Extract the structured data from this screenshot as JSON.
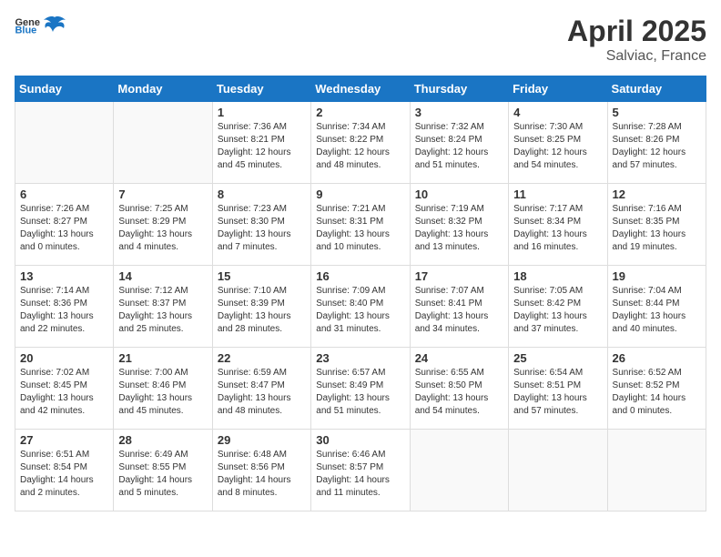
{
  "header": {
    "logo_general": "General",
    "logo_blue": "Blue",
    "title": "April 2025",
    "subtitle": "Salviac, France"
  },
  "days_of_week": [
    "Sunday",
    "Monday",
    "Tuesday",
    "Wednesday",
    "Thursday",
    "Friday",
    "Saturday"
  ],
  "weeks": [
    [
      {
        "day": "",
        "info": ""
      },
      {
        "day": "",
        "info": ""
      },
      {
        "day": "1",
        "info": "Sunrise: 7:36 AM\nSunset: 8:21 PM\nDaylight: 12 hours\nand 45 minutes."
      },
      {
        "day": "2",
        "info": "Sunrise: 7:34 AM\nSunset: 8:22 PM\nDaylight: 12 hours\nand 48 minutes."
      },
      {
        "day": "3",
        "info": "Sunrise: 7:32 AM\nSunset: 8:24 PM\nDaylight: 12 hours\nand 51 minutes."
      },
      {
        "day": "4",
        "info": "Sunrise: 7:30 AM\nSunset: 8:25 PM\nDaylight: 12 hours\nand 54 minutes."
      },
      {
        "day": "5",
        "info": "Sunrise: 7:28 AM\nSunset: 8:26 PM\nDaylight: 12 hours\nand 57 minutes."
      }
    ],
    [
      {
        "day": "6",
        "info": "Sunrise: 7:26 AM\nSunset: 8:27 PM\nDaylight: 13 hours\nand 0 minutes."
      },
      {
        "day": "7",
        "info": "Sunrise: 7:25 AM\nSunset: 8:29 PM\nDaylight: 13 hours\nand 4 minutes."
      },
      {
        "day": "8",
        "info": "Sunrise: 7:23 AM\nSunset: 8:30 PM\nDaylight: 13 hours\nand 7 minutes."
      },
      {
        "day": "9",
        "info": "Sunrise: 7:21 AM\nSunset: 8:31 PM\nDaylight: 13 hours\nand 10 minutes."
      },
      {
        "day": "10",
        "info": "Sunrise: 7:19 AM\nSunset: 8:32 PM\nDaylight: 13 hours\nand 13 minutes."
      },
      {
        "day": "11",
        "info": "Sunrise: 7:17 AM\nSunset: 8:34 PM\nDaylight: 13 hours\nand 16 minutes."
      },
      {
        "day": "12",
        "info": "Sunrise: 7:16 AM\nSunset: 8:35 PM\nDaylight: 13 hours\nand 19 minutes."
      }
    ],
    [
      {
        "day": "13",
        "info": "Sunrise: 7:14 AM\nSunset: 8:36 PM\nDaylight: 13 hours\nand 22 minutes."
      },
      {
        "day": "14",
        "info": "Sunrise: 7:12 AM\nSunset: 8:37 PM\nDaylight: 13 hours\nand 25 minutes."
      },
      {
        "day": "15",
        "info": "Sunrise: 7:10 AM\nSunset: 8:39 PM\nDaylight: 13 hours\nand 28 minutes."
      },
      {
        "day": "16",
        "info": "Sunrise: 7:09 AM\nSunset: 8:40 PM\nDaylight: 13 hours\nand 31 minutes."
      },
      {
        "day": "17",
        "info": "Sunrise: 7:07 AM\nSunset: 8:41 PM\nDaylight: 13 hours\nand 34 minutes."
      },
      {
        "day": "18",
        "info": "Sunrise: 7:05 AM\nSunset: 8:42 PM\nDaylight: 13 hours\nand 37 minutes."
      },
      {
        "day": "19",
        "info": "Sunrise: 7:04 AM\nSunset: 8:44 PM\nDaylight: 13 hours\nand 40 minutes."
      }
    ],
    [
      {
        "day": "20",
        "info": "Sunrise: 7:02 AM\nSunset: 8:45 PM\nDaylight: 13 hours\nand 42 minutes."
      },
      {
        "day": "21",
        "info": "Sunrise: 7:00 AM\nSunset: 8:46 PM\nDaylight: 13 hours\nand 45 minutes."
      },
      {
        "day": "22",
        "info": "Sunrise: 6:59 AM\nSunset: 8:47 PM\nDaylight: 13 hours\nand 48 minutes."
      },
      {
        "day": "23",
        "info": "Sunrise: 6:57 AM\nSunset: 8:49 PM\nDaylight: 13 hours\nand 51 minutes."
      },
      {
        "day": "24",
        "info": "Sunrise: 6:55 AM\nSunset: 8:50 PM\nDaylight: 13 hours\nand 54 minutes."
      },
      {
        "day": "25",
        "info": "Sunrise: 6:54 AM\nSunset: 8:51 PM\nDaylight: 13 hours\nand 57 minutes."
      },
      {
        "day": "26",
        "info": "Sunrise: 6:52 AM\nSunset: 8:52 PM\nDaylight: 14 hours\nand 0 minutes."
      }
    ],
    [
      {
        "day": "27",
        "info": "Sunrise: 6:51 AM\nSunset: 8:54 PM\nDaylight: 14 hours\nand 2 minutes."
      },
      {
        "day": "28",
        "info": "Sunrise: 6:49 AM\nSunset: 8:55 PM\nDaylight: 14 hours\nand 5 minutes."
      },
      {
        "day": "29",
        "info": "Sunrise: 6:48 AM\nSunset: 8:56 PM\nDaylight: 14 hours\nand 8 minutes."
      },
      {
        "day": "30",
        "info": "Sunrise: 6:46 AM\nSunset: 8:57 PM\nDaylight: 14 hours\nand 11 minutes."
      },
      {
        "day": "",
        "info": ""
      },
      {
        "day": "",
        "info": ""
      },
      {
        "day": "",
        "info": ""
      }
    ]
  ]
}
